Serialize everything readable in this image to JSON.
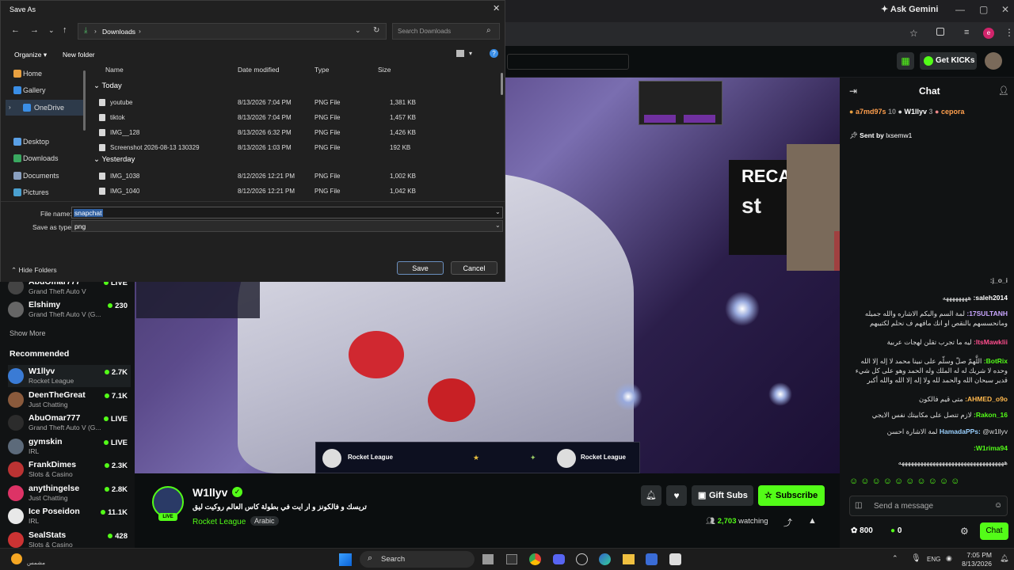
{
  "browser": {
    "ask_gemini": "Ask Gemini",
    "profile_initial": "e"
  },
  "kick": {
    "get_kicks": "Get KICKs"
  },
  "dialog": {
    "title": "Save As",
    "path_folder": "Downloads",
    "search_placeholder": "Search Downloads",
    "organize": "Organize",
    "new_folder": "New folder",
    "columns": {
      "name": "Name",
      "date": "Date modified",
      "type": "Type",
      "size": "Size"
    },
    "nav": [
      {
        "label": "Home"
      },
      {
        "label": "Gallery"
      },
      {
        "label": "OneDrive"
      },
      {
        "label": "Desktop"
      },
      {
        "label": "Downloads"
      },
      {
        "label": "Documents"
      },
      {
        "label": "Pictures"
      }
    ],
    "groups": {
      "today": "Today",
      "yesterday": "Yesterday"
    },
    "files": [
      {
        "name": "youtube",
        "date": "8/13/2026 7:04 PM",
        "type": "PNG File",
        "size": "1,381 KB"
      },
      {
        "name": "tiktok",
        "date": "8/13/2026 7:04 PM",
        "type": "PNG File",
        "size": "1,457 KB"
      },
      {
        "name": "IMG__128",
        "date": "8/13/2026 6:32 PM",
        "type": "PNG File",
        "size": "1,426 KB"
      },
      {
        "name": "Screenshot 2026-08-13 130329",
        "date": "8/13/2026 1:03 PM",
        "type": "PNG File",
        "size": "192 KB"
      },
      {
        "name": "IMG_1038",
        "date": "8/12/2026 12:21 PM",
        "type": "PNG File",
        "size": "1,002 KB"
      },
      {
        "name": "IMG_1040",
        "date": "8/12/2026 12:21 PM",
        "type": "PNG File",
        "size": "1,042 KB"
      }
    ],
    "file_name_label": "File name:",
    "file_name_value": "snapchat",
    "save_type_label": "Save as type:",
    "save_type_value": "png",
    "hide_folders": "Hide Folders",
    "save": "Save",
    "cancel": "Cancel"
  },
  "sidebar": {
    "partial": [
      {
        "name": "AbuOmar777",
        "sub": "Grand Theft Auto V",
        "count": "LIVE"
      },
      {
        "name": "Elshimy",
        "sub": "Grand Theft Auto V (G...",
        "count": "230"
      }
    ],
    "show_more": "Show More",
    "recommended_title": "Recommended",
    "recommended": [
      {
        "name": "W1llyv",
        "sub": "Rocket League",
        "count": "2.7K",
        "color": "#3a7bd5"
      },
      {
        "name": "DeenTheGreat",
        "sub": "Just Chatting",
        "count": "7.1K",
        "color": "#8a5a3c"
      },
      {
        "name": "AbuOmar777",
        "sub": "Grand Theft Auto V (G...",
        "count": "LIVE",
        "color": "#2c2c2c"
      },
      {
        "name": "gymskin",
        "sub": "IRL",
        "count": "LIVE",
        "color": "#5c6a7a"
      },
      {
        "name": "FrankDimes",
        "sub": "Slots & Casino",
        "count": "2.3K",
        "color": "#b33"
      },
      {
        "name": "anythingelse",
        "sub": "Just Chatting",
        "count": "2.8K",
        "color": "#d36"
      },
      {
        "name": "Ice Poseidon",
        "sub": "IRL",
        "count": "11.1K",
        "color": "#e8e8e8"
      },
      {
        "name": "SealStats",
        "sub": "Slots & Casino",
        "count": "428",
        "color": "#c33"
      }
    ]
  },
  "video": {
    "recap_text": "RECA",
    "scoreboard_left": "Rocket League",
    "scoreboard_right": "Rocket League"
  },
  "stream": {
    "streamer": "W1llyv",
    "title": "تريسك و فالكونز و ار ايت في بطولة كاس العالم روكيت ليق",
    "category": "Rocket League",
    "language": "Arabic",
    "live_badge": "LIVE",
    "gift_subs": "Gift Subs",
    "subscribe": "Subscribe",
    "viewers": "2,703",
    "watching_label": "watching"
  },
  "chat": {
    "title": "Chat",
    "top_users": [
      {
        "name": "a7md97s",
        "count": "10"
      },
      {
        "name": "W1llyv",
        "count": "3"
      },
      {
        "name": "cepora",
        "count": ""
      }
    ],
    "sent_by_label": "Sent by",
    "sent_by_user": "lxsemw1",
    "messages": [
      {
        "user": "j_o_i:",
        "text": "",
        "color": "#bbbbbb"
      },
      {
        "user": "saleh2014:",
        "text": "ههههههههه",
        "color": "#ffffff"
      },
      {
        "user": "17SULTANH:",
        "text": "لمة السم والبكم الاشاره والله جميله ومانحسسهم بالنقص او انك مافهم ف نحلم لكتيبهم",
        "color": "#c9a6ff"
      },
      {
        "user": "ItsMawklii:",
        "text": "ليه ما تجرب تقلن لهجات عربية",
        "color": "#ff4d8d"
      },
      {
        "user": "BotRix:",
        "text": "اللَّهمّ صلّ وسلّم على نبينا محمد لا إله إلا الله وحده لا شريك له له الملك وله الحمد وهو على كل شيء قدير سبحان الله والحمد لله ولا إله إلا الله والله أكبر",
        "color": "#53fc18"
      },
      {
        "user": "AHMED_o9o:",
        "text": "متى قيم فالكون",
        "color": "#ffb84d"
      },
      {
        "user": "Rakon_16:",
        "text": "لازم تتصل على مكابيتك نفس الايجي",
        "color": "#53fc18"
      },
      {
        "user": "HamadaPPs:",
        "text": "@w1llyv لمة الاشارة احسن",
        "color": "#9ad0ff"
      },
      {
        "user": "W1rima94:",
        "text": "",
        "color": "#53fc18"
      },
      {
        "user": "",
        "text": "ههههههههههههههههههههههههههههههههههه",
        "color": "#ffffff"
      }
    ],
    "send_placeholder": "Send a message",
    "points": "800",
    "kicks": "0",
    "chat_button": "Chat"
  },
  "taskbar": {
    "weather_temp": "",
    "weather_label": "مشمس",
    "search": "Search",
    "lang": "ENG",
    "time": "7:05 PM",
    "date": "8/13/2026"
  }
}
